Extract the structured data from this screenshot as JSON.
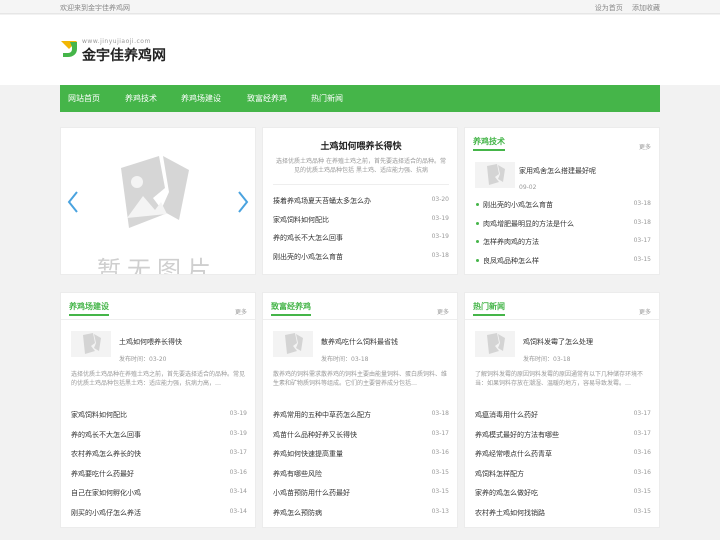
{
  "topbar": {
    "welcome": "欢迎来到金宇佳养鸡网",
    "set_home": "设为首页",
    "add_fav": "添加收藏"
  },
  "logo": {
    "name": "金宇佳养鸡网",
    "domain": "www.jinyujiaoji.com"
  },
  "nav": [
    "网站首页",
    "养鸡技术",
    "养鸡场建设",
    "致富经养鸡",
    "热门新闻"
  ],
  "slider": {
    "placeholder": "暂无图片"
  },
  "feature": {
    "title": "土鸡如何喂养长得快",
    "desc": "选择优质土鸡品种 在养殖土鸡之前，首先要选择适合的品种。常见的优质土鸡品种包括 黑土鸡、适应能力强、抗病",
    "items": [
      {
        "t": "揍着养鸡场夏天苔蛹太多怎么办",
        "d": "03-20"
      },
      {
        "t": "家鸡饲料如何配比",
        "d": "03-19"
      },
      {
        "t": "养的鸡长不大怎么回事",
        "d": "03-19"
      },
      {
        "t": "刚出壳的小鸡怎么育苗",
        "d": "03-18"
      }
    ]
  },
  "tech": {
    "title": "养鸡技术",
    "more": "更多",
    "top": {
      "title": "家用鸡舍怎么搭建最好呢",
      "date": "09-02"
    },
    "items": [
      {
        "t": "刚出壳的小鸡怎么育苗",
        "d": "03-18"
      },
      {
        "t": "肉鸡增肥最明显的方法是什么",
        "d": "03-18"
      },
      {
        "t": "怎样养肉鸡的方法",
        "d": "03-17"
      },
      {
        "t": "良凤鸡品种怎么样",
        "d": "03-15"
      }
    ]
  },
  "sections": [
    {
      "title": "养鸡场建设",
      "more": "更多",
      "top": {
        "title": "土鸡如何喂养长得快",
        "date_label": "发布时间：",
        "date": "03-20",
        "desc": "选择优质土鸡品种在养殖土鸡之前，首先要选择适合的品种。常见的优质土鸡品种包括黑土鸡：适应能力强，抗病力高，…"
      },
      "items": [
        {
          "t": "家鸡饲料如何配比",
          "d": "03-19"
        },
        {
          "t": "养的鸡长不大怎么回事",
          "d": "03-19"
        },
        {
          "t": "农村养鸡怎么养长的快",
          "d": "03-17"
        },
        {
          "t": "养鸡要吃什么药最好",
          "d": "03-16"
        },
        {
          "t": "自己在家如何孵化小鸡",
          "d": "03-14"
        },
        {
          "t": "刚买的小鸡仔怎么养活",
          "d": "03-14"
        }
      ]
    },
    {
      "title": "致富经养鸡",
      "more": "更多",
      "top": {
        "title": "散养鸡吃什么饲料最省钱",
        "date_label": "发布时间：",
        "date": "03-18",
        "desc": "散养鸡的饲料需求散养鸡的饲料主要由能量饲料、蛋白质饲料、维生素和矿物质饲料等组成。它们的主要营养成分包括…"
      },
      "items": [
        {
          "t": "养鸡常用的五种中草药怎么配方",
          "d": "03-18"
        },
        {
          "t": "鸡苗什么品种好养又长得快",
          "d": "03-17"
        },
        {
          "t": "养鸡如何快速提高重量",
          "d": "03-16"
        },
        {
          "t": "养鸡有哪些风险",
          "d": "03-15"
        },
        {
          "t": "小鸡苗预防用什么药最好",
          "d": "03-15"
        },
        {
          "t": "养鸡怎么预防病",
          "d": "03-13"
        }
      ]
    },
    {
      "title": "热门新闻",
      "more": "更多",
      "top": {
        "title": "鸡饲料发霉了怎么处理",
        "date_label": "发布时间：",
        "date": "03-18",
        "desc": "了解饲料发霉的原因饲料发霉的原因通常有以下几种储存环境不当：如果饲料存放在潮湿、温暖的地方，容易导致发霉。…"
      },
      "items": [
        {
          "t": "鸡瘟消毒用什么药好",
          "d": "03-17"
        },
        {
          "t": "养鸡模式最好的方法有哪些",
          "d": "03-17"
        },
        {
          "t": "养鸡经常喂点什么药青草",
          "d": "03-16"
        },
        {
          "t": "鸡饲料怎样配方",
          "d": "03-16"
        },
        {
          "t": "家养的鸡怎么做好吃",
          "d": "03-15"
        },
        {
          "t": "农村养土鸡如何找销路",
          "d": "03-15"
        }
      ]
    }
  ],
  "colors": {
    "accent": "#45b549",
    "bg": "#f2f2f2",
    "logo_yellow": "#f2b705"
  }
}
